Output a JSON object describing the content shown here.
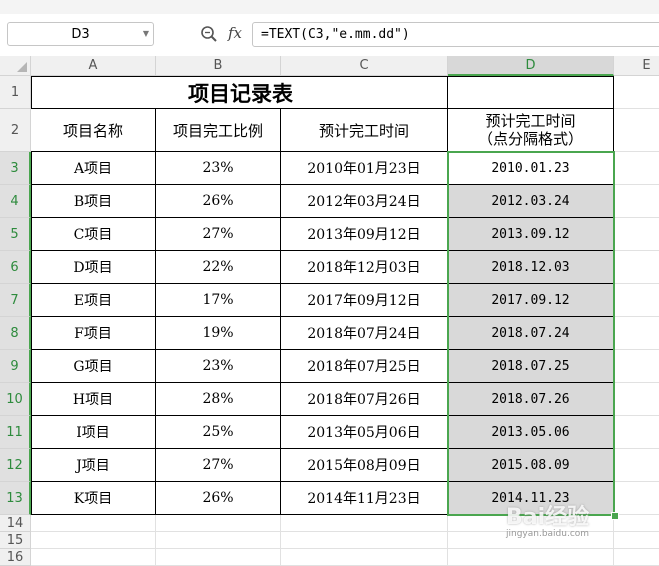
{
  "name_box": {
    "value": "D3"
  },
  "formula_bar": {
    "fx_label": "fx",
    "formula": "=TEXT(C3,\"e.mm.dd\")"
  },
  "columns": [
    "A",
    "B",
    "C",
    "D",
    "E"
  ],
  "row_numbers": [
    "1",
    "2",
    "3",
    "4",
    "5",
    "6",
    "7",
    "8",
    "9",
    "10",
    "11",
    "12",
    "13",
    "14",
    "15",
    "16"
  ],
  "sheet": {
    "title": "项目记录表",
    "headers": [
      "项目名称",
      "项目完工比例",
      "预计完工时间",
      "预计完工时间",
      "（点分隔格式）"
    ],
    "rows": [
      [
        "A项目",
        "23%",
        "2010年01月23日",
        "2010.01.23"
      ],
      [
        "B项目",
        "26%",
        "2012年03月24日",
        "2012.03.24"
      ],
      [
        "C项目",
        "27%",
        "2013年09月12日",
        "2013.09.12"
      ],
      [
        "D项目",
        "22%",
        "2018年12月03日",
        "2018.12.03"
      ],
      [
        "E项目",
        "17%",
        "2017年09月12日",
        "2017.09.12"
      ],
      [
        "F项目",
        "19%",
        "2018年07月24日",
        "2018.07.24"
      ],
      [
        "G项目",
        "23%",
        "2018年07月25日",
        "2018.07.25"
      ],
      [
        "H项目",
        "28%",
        "2018年07月26日",
        "2018.07.26"
      ],
      [
        "I项目",
        "25%",
        "2013年05月06日",
        "2013.05.06"
      ],
      [
        "J项目",
        "27%",
        "2015年08月09日",
        "2015.08.09"
      ],
      [
        "K项目",
        "26%",
        "2014年11月23日",
        "2014.11.23"
      ]
    ]
  },
  "watermark": {
    "text": "Bai经验",
    "sub": "jingyan.baidu.com"
  },
  "colors": {
    "selection": "#4aa64f",
    "selected_fill": "#d9d9d9"
  }
}
